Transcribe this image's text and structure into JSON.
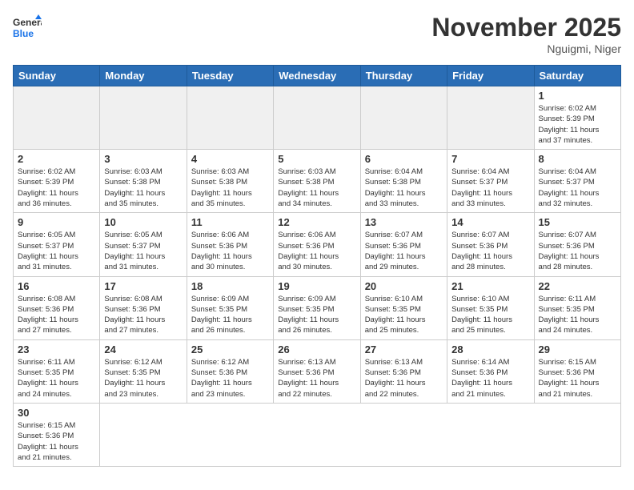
{
  "logo": {
    "line1": "General",
    "line2": "Blue"
  },
  "title": "November 2025",
  "subtitle": "Nguigmi, Niger",
  "weekdays": [
    "Sunday",
    "Monday",
    "Tuesday",
    "Wednesday",
    "Thursday",
    "Friday",
    "Saturday"
  ],
  "days": [
    {
      "date": null,
      "info": ""
    },
    {
      "date": null,
      "info": ""
    },
    {
      "date": null,
      "info": ""
    },
    {
      "date": null,
      "info": ""
    },
    {
      "date": null,
      "info": ""
    },
    {
      "date": null,
      "info": ""
    },
    {
      "date": "1",
      "info": "Sunrise: 6:02 AM\nSunset: 5:39 PM\nDaylight: 11 hours\nand 37 minutes."
    },
    {
      "date": "2",
      "info": "Sunrise: 6:02 AM\nSunset: 5:39 PM\nDaylight: 11 hours\nand 36 minutes."
    },
    {
      "date": "3",
      "info": "Sunrise: 6:03 AM\nSunset: 5:38 PM\nDaylight: 11 hours\nand 35 minutes."
    },
    {
      "date": "4",
      "info": "Sunrise: 6:03 AM\nSunset: 5:38 PM\nDaylight: 11 hours\nand 35 minutes."
    },
    {
      "date": "5",
      "info": "Sunrise: 6:03 AM\nSunset: 5:38 PM\nDaylight: 11 hours\nand 34 minutes."
    },
    {
      "date": "6",
      "info": "Sunrise: 6:04 AM\nSunset: 5:38 PM\nDaylight: 11 hours\nand 33 minutes."
    },
    {
      "date": "7",
      "info": "Sunrise: 6:04 AM\nSunset: 5:37 PM\nDaylight: 11 hours\nand 33 minutes."
    },
    {
      "date": "8",
      "info": "Sunrise: 6:04 AM\nSunset: 5:37 PM\nDaylight: 11 hours\nand 32 minutes."
    },
    {
      "date": "9",
      "info": "Sunrise: 6:05 AM\nSunset: 5:37 PM\nDaylight: 11 hours\nand 31 minutes."
    },
    {
      "date": "10",
      "info": "Sunrise: 6:05 AM\nSunset: 5:37 PM\nDaylight: 11 hours\nand 31 minutes."
    },
    {
      "date": "11",
      "info": "Sunrise: 6:06 AM\nSunset: 5:36 PM\nDaylight: 11 hours\nand 30 minutes."
    },
    {
      "date": "12",
      "info": "Sunrise: 6:06 AM\nSunset: 5:36 PM\nDaylight: 11 hours\nand 30 minutes."
    },
    {
      "date": "13",
      "info": "Sunrise: 6:07 AM\nSunset: 5:36 PM\nDaylight: 11 hours\nand 29 minutes."
    },
    {
      "date": "14",
      "info": "Sunrise: 6:07 AM\nSunset: 5:36 PM\nDaylight: 11 hours\nand 28 minutes."
    },
    {
      "date": "15",
      "info": "Sunrise: 6:07 AM\nSunset: 5:36 PM\nDaylight: 11 hours\nand 28 minutes."
    },
    {
      "date": "16",
      "info": "Sunrise: 6:08 AM\nSunset: 5:36 PM\nDaylight: 11 hours\nand 27 minutes."
    },
    {
      "date": "17",
      "info": "Sunrise: 6:08 AM\nSunset: 5:36 PM\nDaylight: 11 hours\nand 27 minutes."
    },
    {
      "date": "18",
      "info": "Sunrise: 6:09 AM\nSunset: 5:35 PM\nDaylight: 11 hours\nand 26 minutes."
    },
    {
      "date": "19",
      "info": "Sunrise: 6:09 AM\nSunset: 5:35 PM\nDaylight: 11 hours\nand 26 minutes."
    },
    {
      "date": "20",
      "info": "Sunrise: 6:10 AM\nSunset: 5:35 PM\nDaylight: 11 hours\nand 25 minutes."
    },
    {
      "date": "21",
      "info": "Sunrise: 6:10 AM\nSunset: 5:35 PM\nDaylight: 11 hours\nand 25 minutes."
    },
    {
      "date": "22",
      "info": "Sunrise: 6:11 AM\nSunset: 5:35 PM\nDaylight: 11 hours\nand 24 minutes."
    },
    {
      "date": "23",
      "info": "Sunrise: 6:11 AM\nSunset: 5:35 PM\nDaylight: 11 hours\nand 24 minutes."
    },
    {
      "date": "24",
      "info": "Sunrise: 6:12 AM\nSunset: 5:35 PM\nDaylight: 11 hours\nand 23 minutes."
    },
    {
      "date": "25",
      "info": "Sunrise: 6:12 AM\nSunset: 5:36 PM\nDaylight: 11 hours\nand 23 minutes."
    },
    {
      "date": "26",
      "info": "Sunrise: 6:13 AM\nSunset: 5:36 PM\nDaylight: 11 hours\nand 22 minutes."
    },
    {
      "date": "27",
      "info": "Sunrise: 6:13 AM\nSunset: 5:36 PM\nDaylight: 11 hours\nand 22 minutes."
    },
    {
      "date": "28",
      "info": "Sunrise: 6:14 AM\nSunset: 5:36 PM\nDaylight: 11 hours\nand 21 minutes."
    },
    {
      "date": "29",
      "info": "Sunrise: 6:15 AM\nSunset: 5:36 PM\nDaylight: 11 hours\nand 21 minutes."
    },
    {
      "date": "30",
      "info": "Sunrise: 6:15 AM\nSunset: 5:36 PM\nDaylight: 11 hours\nand 21 minutes."
    }
  ]
}
